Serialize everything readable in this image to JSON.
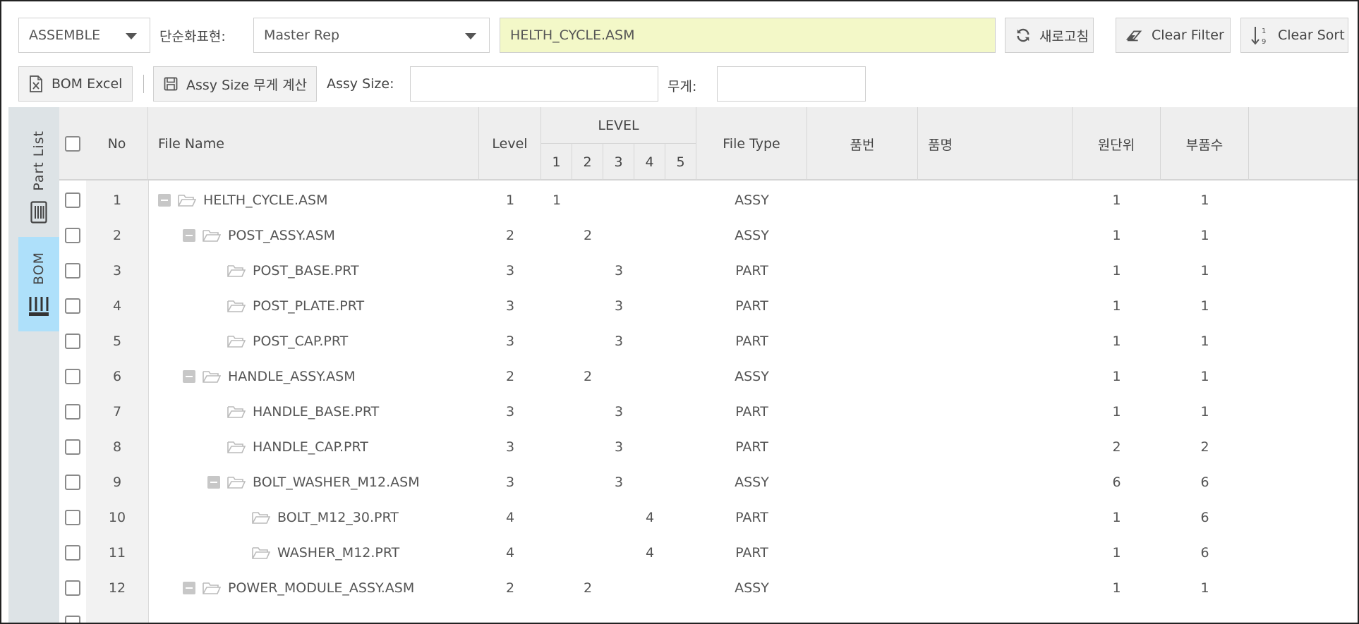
{
  "toolbar": {
    "mode_select": "ASSEMBLE",
    "simplified_rep_label": "단순화표현:",
    "simplified_rep_select": "Master Rep",
    "file_value": "HELTH_CYCLE.ASM",
    "refresh_label": "새로고침",
    "clear_filter_label": "Clear Filter",
    "clear_sort_label": "Clear Sort",
    "bom_excel_label": "BOM Excel",
    "assy_size_calc_label": "Assy Size 무게 계산",
    "assy_size_label": "Assy Size:",
    "assy_size_value": "",
    "weight_label": "무게:",
    "weight_value": "",
    "sort_icon_digits": [
      "1",
      "9"
    ]
  },
  "side_tabs": [
    {
      "label": "Part  List",
      "active": false
    },
    {
      "label": "BOM",
      "active": true
    }
  ],
  "columns": {
    "no": "No",
    "file_name": "File Name",
    "level": "Level",
    "level_group": "LEVEL",
    "level_sub": [
      "1",
      "2",
      "3",
      "4",
      "5"
    ],
    "file_type": "File Type",
    "part_no": "품번",
    "part_name": "품명",
    "unit": "원단위",
    "qty": "부품수"
  },
  "rows": [
    {
      "no": "1",
      "name": "HELTH_CYCLE.ASM",
      "indent": 0,
      "expandable": true,
      "level": "1",
      "type": "ASSY",
      "unit": "1",
      "qty": "1"
    },
    {
      "no": "2",
      "name": "POST_ASSY.ASM",
      "indent": 1,
      "expandable": true,
      "level": "2",
      "type": "ASSY",
      "unit": "1",
      "qty": "1"
    },
    {
      "no": "3",
      "name": "POST_BASE.PRT",
      "indent": 2,
      "expandable": false,
      "level": "3",
      "type": "PART",
      "unit": "1",
      "qty": "1"
    },
    {
      "no": "4",
      "name": "POST_PLATE.PRT",
      "indent": 2,
      "expandable": false,
      "level": "3",
      "type": "PART",
      "unit": "1",
      "qty": "1"
    },
    {
      "no": "5",
      "name": "POST_CAP.PRT",
      "indent": 2,
      "expandable": false,
      "level": "3",
      "type": "PART",
      "unit": "1",
      "qty": "1"
    },
    {
      "no": "6",
      "name": "HANDLE_ASSY.ASM",
      "indent": 1,
      "expandable": true,
      "level": "2",
      "type": "ASSY",
      "unit": "1",
      "qty": "1"
    },
    {
      "no": "7",
      "name": "HANDLE_BASE.PRT",
      "indent": 2,
      "expandable": false,
      "level": "3",
      "type": "PART",
      "unit": "1",
      "qty": "1"
    },
    {
      "no": "8",
      "name": "HANDLE_CAP.PRT",
      "indent": 2,
      "expandable": false,
      "level": "3",
      "type": "PART",
      "unit": "2",
      "qty": "2"
    },
    {
      "no": "9",
      "name": "BOLT_WASHER_M12.ASM",
      "indent": 2,
      "expandable": true,
      "level": "3",
      "type": "ASSY",
      "unit": "6",
      "qty": "6"
    },
    {
      "no": "10",
      "name": "BOLT_M12_30.PRT",
      "indent": 3,
      "expandable": false,
      "level": "4",
      "type": "PART",
      "unit": "1",
      "qty": "6"
    },
    {
      "no": "11",
      "name": "WASHER_M12.PRT",
      "indent": 3,
      "expandable": false,
      "level": "4",
      "type": "PART",
      "unit": "1",
      "qty": "6"
    },
    {
      "no": "12",
      "name": "POWER_MODULE_ASSY.ASM",
      "indent": 1,
      "expandable": true,
      "level": "2",
      "type": "ASSY",
      "unit": "1",
      "qty": "1"
    }
  ]
}
